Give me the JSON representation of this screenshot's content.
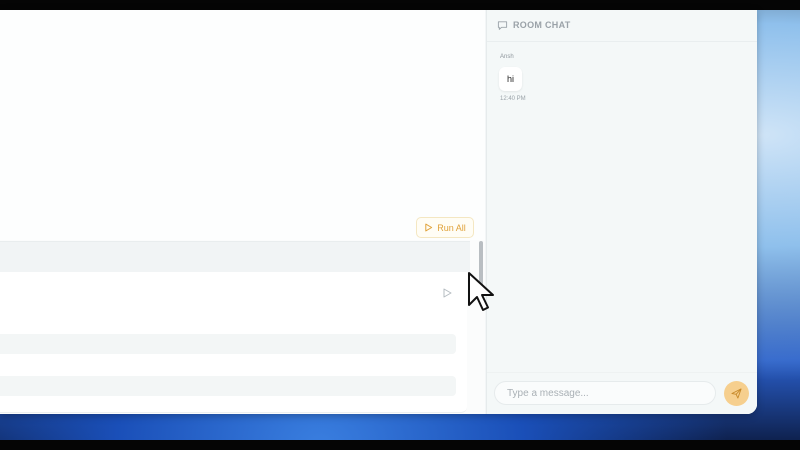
{
  "editor": {
    "run_all_label": "Run All"
  },
  "chat": {
    "title": "ROOM CHAT",
    "icon": "chat-bubble-icon",
    "messages": [
      {
        "author": "Ansh",
        "text": "hi",
        "time": "12:40 PM"
      }
    ],
    "input_placeholder": "Type a message...",
    "send_icon": "send-icon"
  },
  "colors": {
    "accent": "#f6cf8e",
    "run_all_text": "#e0a23a"
  }
}
